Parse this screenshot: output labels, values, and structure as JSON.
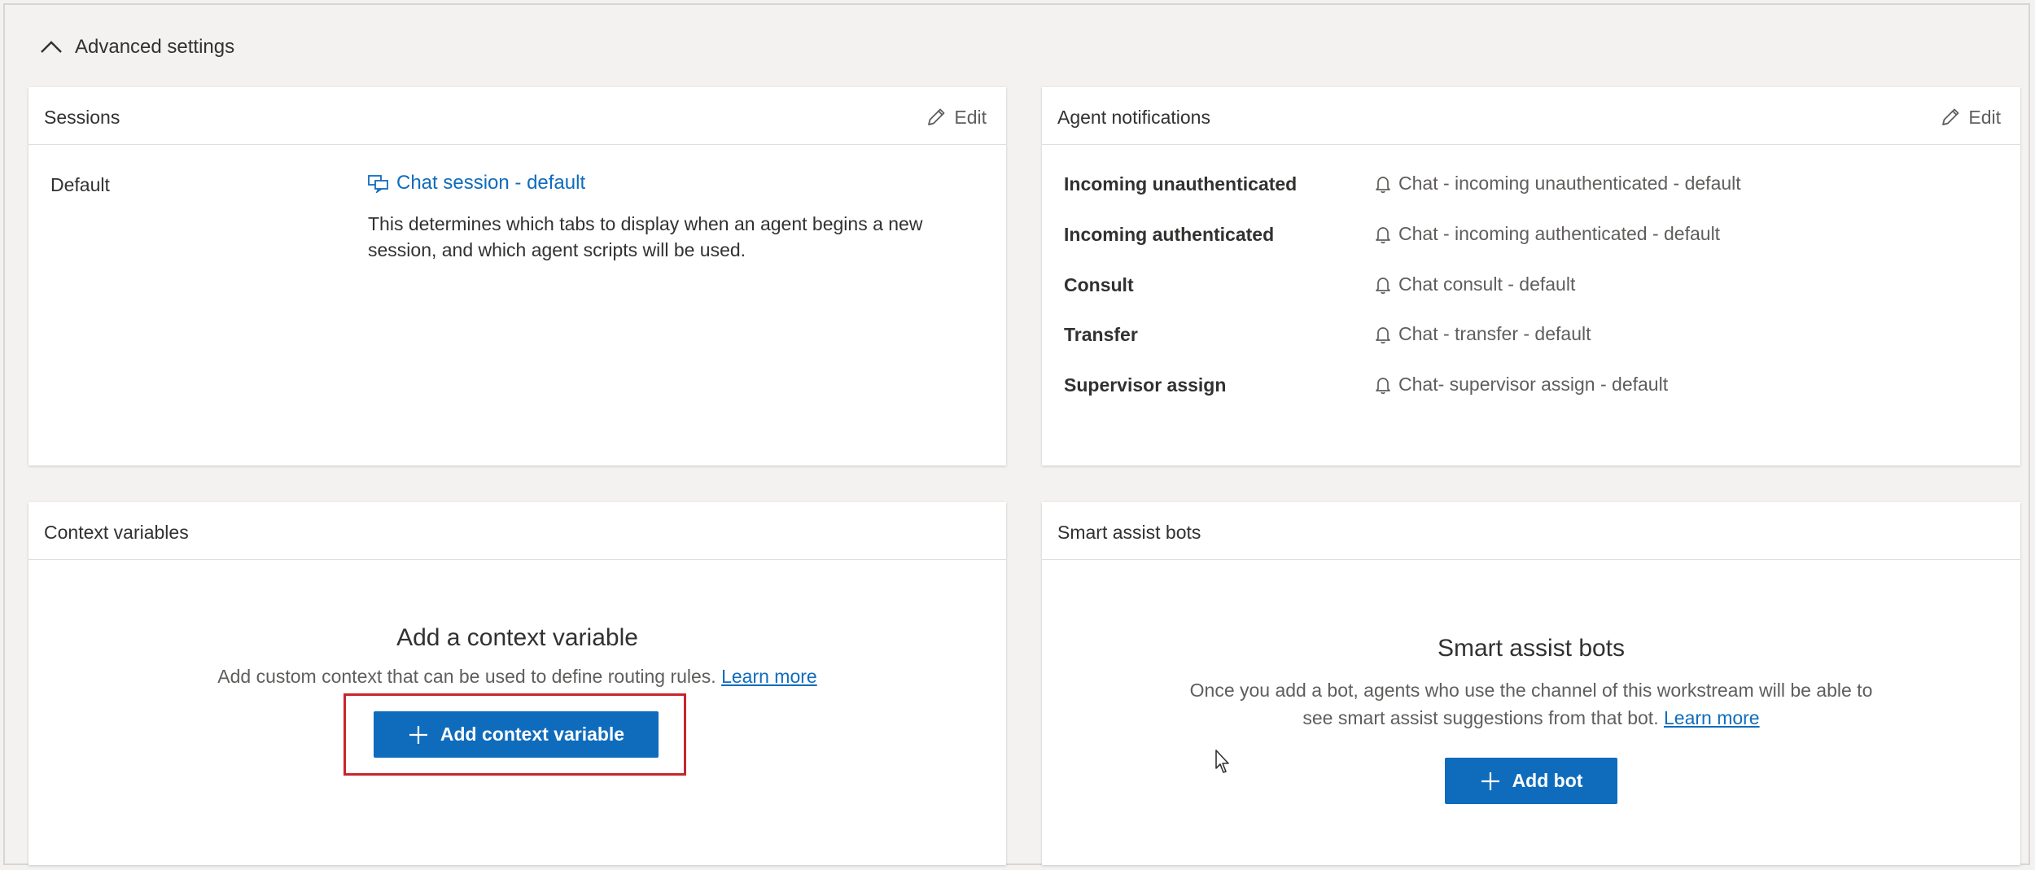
{
  "advanced": {
    "label": "Advanced settings"
  },
  "sessions": {
    "title": "Sessions",
    "edit_label": "Edit",
    "row_label": "Default",
    "link_text": "Chat session - default",
    "description": "This determines which tabs to display when an agent begins a new session, and which agent scripts will be used."
  },
  "notifications": {
    "title": "Agent notifications",
    "edit_label": "Edit",
    "rows": [
      {
        "label": "Incoming unauthenticated",
        "value": "Chat - incoming unauthenticated - default"
      },
      {
        "label": "Incoming authenticated",
        "value": "Chat - incoming authenticated - default"
      },
      {
        "label": "Consult",
        "value": "Chat consult - default"
      },
      {
        "label": "Transfer",
        "value": "Chat - transfer - default"
      },
      {
        "label": "Supervisor assign",
        "value": "Chat- supervisor assign - default"
      }
    ]
  },
  "context": {
    "title": "Context variables",
    "empty_title": "Add a context variable",
    "empty_desc": "Add custom context that can be used to define routing rules.",
    "learn_more": "Learn more",
    "button_label": "Add context variable"
  },
  "smartbots": {
    "title": "Smart assist bots",
    "empty_title": "Smart assist bots",
    "empty_desc": "Once you add a bot, agents who use the channel of this workstream will be able to see smart assist suggestions from that bot.",
    "learn_more": "Learn more",
    "button_label": "Add bot"
  },
  "colors": {
    "accent": "#0f6cbd",
    "highlight": "#c8252c",
    "background": "#f3f2f1"
  },
  "icons": [
    "chevron-up-icon",
    "pencil-icon",
    "chat-session-icon",
    "bell-icon",
    "plus-icon",
    "mouse-cursor-icon"
  ]
}
